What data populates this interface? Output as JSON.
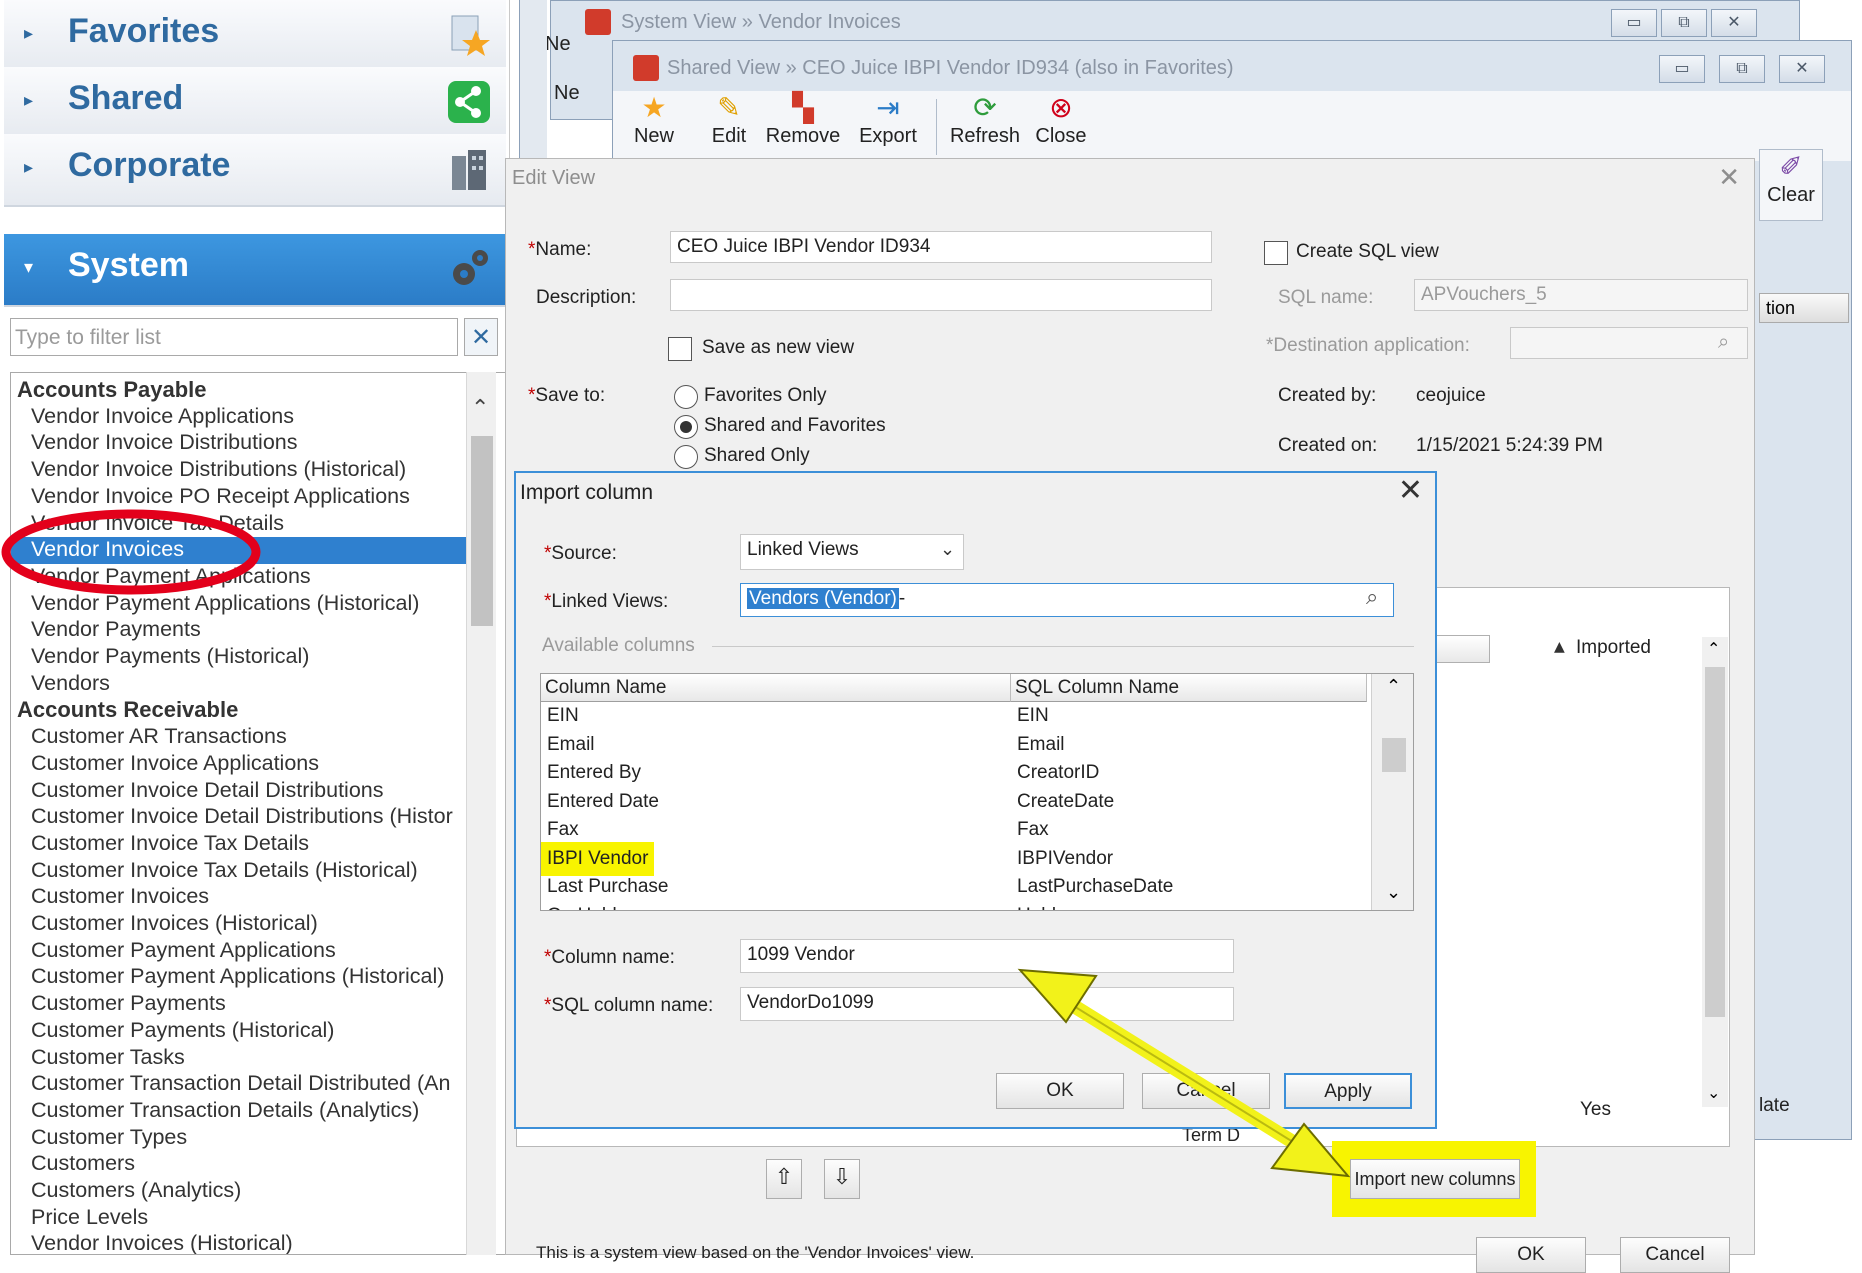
{
  "nav": {
    "sections": [
      {
        "label": "Favorites"
      },
      {
        "label": "Shared"
      },
      {
        "label": "Corporate"
      },
      {
        "label": "System"
      }
    ],
    "filter_placeholder": "Type to filter list",
    "filter_clear": "✕",
    "groups": [
      {
        "name": "Accounts Payable",
        "items": [
          "Vendor Invoice Applications",
          "Vendor Invoice Distributions",
          "Vendor Invoice Distributions (Historical)",
          "Vendor Invoice PO Receipt Applications",
          "Vendor Invoice Tax Details",
          "Vendor Invoices",
          "Vendor Payment Applications",
          "Vendor Payment Applications (Historical)",
          "Vendor Payments",
          "Vendor Payments (Historical)",
          "Vendors"
        ]
      },
      {
        "name": "Accounts Receivable",
        "items": [
          "Customer AR Transactions",
          "Customer Invoice Applications",
          "Customer Invoice Detail Distributions",
          "Customer Invoice Detail Distributions (Histor",
          "Customer Invoice Tax Details",
          "Customer Invoice Tax Details (Historical)",
          "Customer Invoices",
          "Customer Invoices (Historical)",
          "Customer Payment Applications",
          "Customer Payment Applications (Historical)",
          "Customer Payments",
          "Customer Payments (Historical)",
          "Customer Tasks",
          "Customer Transaction Detail Distributed (An",
          "Customer Transaction Details (Analytics)",
          "Customer Types",
          "Customers",
          "Customers (Analytics)",
          "Price Levels",
          "Vendor Invoices (Historical)"
        ]
      }
    ]
  },
  "windows": {
    "system_title": "System View » Vendor Invoices",
    "shared_title": "Shared View » CEO Juice IBPI Vendor ID934  (also in Favorites)",
    "frag_new": "Ne",
    "frag_new2": "Ne",
    "toolbar": {
      "new": "New",
      "edit": "Edit",
      "remove": "Remove",
      "export": "Export",
      "refresh": "Refresh",
      "close": "Close",
      "clear": "Clear"
    },
    "btn_min": "▭",
    "btn_max": "⧉",
    "btn_close": "✕"
  },
  "edit_view": {
    "title": "Edit View",
    "name_label": "Name:",
    "name_value": "CEO Juice IBPI Vendor ID934",
    "description_label": "Description:",
    "description_value": "",
    "save_as_new": "Save as new view",
    "save_to_label": "Save to:",
    "save_options": [
      "Favorites Only",
      "Shared and Favorites",
      "Shared Only"
    ],
    "create_sql": "Create SQL view",
    "sql_name_label": "SQL name:",
    "sql_name_value": "APVouchers_5",
    "dest_app_label": "Destination application:",
    "created_by_label": "Created by:",
    "created_by_value": "ceojuice",
    "created_on_label": "Created on:",
    "created_on_value": "1/15/2021 5:24:39 PM",
    "grid_col_frag": "tion",
    "imported_header": "Imported",
    "yes_value": "Yes",
    "date_frag": "late",
    "term_frag": "Term D",
    "import_new_columns": "Import new columns",
    "footer_text": "This is a system view based on the 'Vendor Invoices' view.",
    "ok": "OK",
    "cancel": "Cancel",
    "move_up": "⇧",
    "move_down": "⇩"
  },
  "import_column": {
    "title": "Import column",
    "source_label": "Source:",
    "source_value": "Linked Views",
    "linked_views_label": "Linked Views:",
    "linked_views_value": "Vendors (Vendor)",
    "available_columns": "Available columns",
    "headers": [
      "Column Name",
      "SQL Column Name"
    ],
    "rows": [
      [
        "EIN",
        "EIN"
      ],
      [
        "Email",
        "Email"
      ],
      [
        "Entered By",
        "CreatorID"
      ],
      [
        "Entered Date",
        "CreateDate"
      ],
      [
        "Fax",
        "Fax"
      ],
      [
        "IBPI Vendor",
        "IBPIVendor"
      ],
      [
        "Last Purchase",
        "LastPurchaseDate"
      ],
      [
        "On Hold",
        "Hold"
      ]
    ],
    "column_name_label": "Column name:",
    "column_name_value": "1099 Vendor",
    "sql_column_name_label": "SQL column name:",
    "sql_column_name_value": "VendorDo1099",
    "ok": "OK",
    "cancel": "Cancel",
    "apply": "Apply"
  },
  "colors": {
    "nav_text": "#2f6aa0",
    "selected": "#2f80cf",
    "dialog_border": "#3c8fd8",
    "highlight_yellow": "#f8f400",
    "arrow_yellow": "#f2f21a",
    "circle_red": "#e3001b"
  }
}
